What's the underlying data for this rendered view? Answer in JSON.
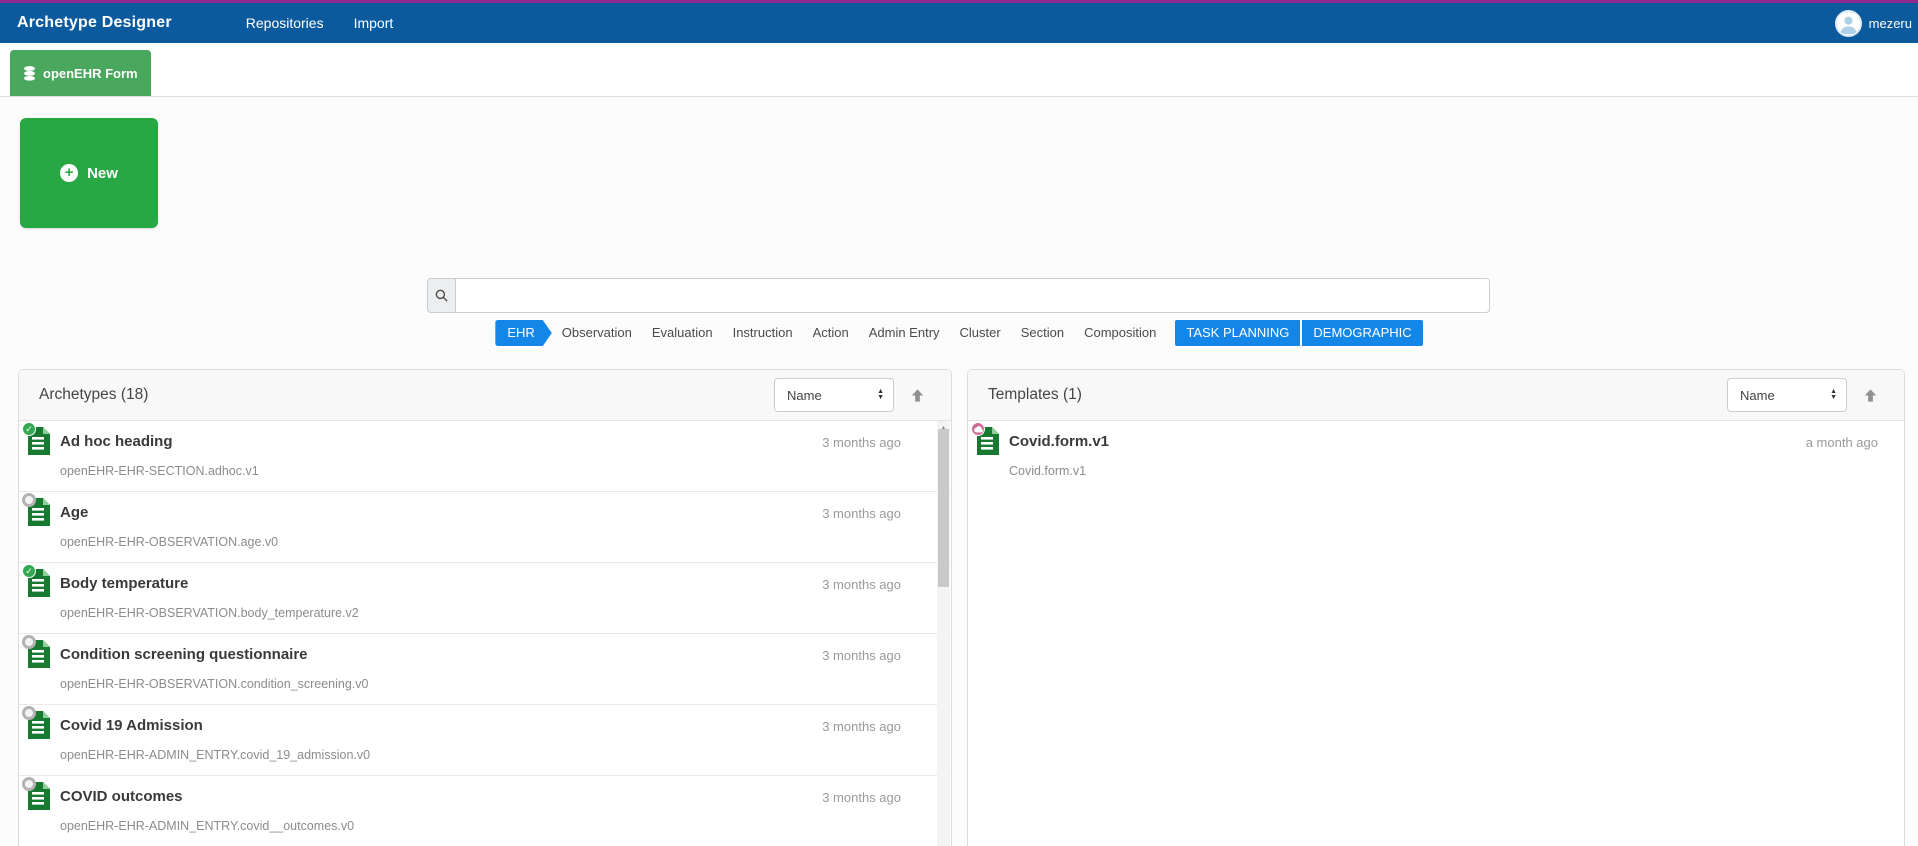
{
  "navbar": {
    "brand": "Archetype Designer",
    "links": [
      {
        "label": "Repositories"
      },
      {
        "label": "Import"
      }
    ],
    "user": "mezeru"
  },
  "tab": {
    "label": "openEHR Form"
  },
  "actions": {
    "new_label": "New"
  },
  "search": {
    "value": "",
    "placeholder": ""
  },
  "filters": {
    "active_primary": "EHR",
    "plain": [
      "Observation",
      "Evaluation",
      "Instruction",
      "Action",
      "Admin Entry",
      "Cluster",
      "Section",
      "Composition"
    ],
    "active_solid": [
      "TASK PLANNING",
      "DEMOGRAPHIC"
    ]
  },
  "archetypes_panel": {
    "title": "Archetypes (18)",
    "sort_value": "Name",
    "items": [
      {
        "name": "Ad hoc heading",
        "id": "openEHR-EHR-SECTION.adhoc.v1",
        "time": "3 months ago",
        "status": "checked"
      },
      {
        "name": "Age",
        "id": "openEHR-EHR-OBSERVATION.age.v0",
        "time": "3 months ago",
        "status": "unchecked"
      },
      {
        "name": "Body temperature",
        "id": "openEHR-EHR-OBSERVATION.body_temperature.v2",
        "time": "3 months ago",
        "status": "checked"
      },
      {
        "name": "Condition screening questionnaire",
        "id": "openEHR-EHR-OBSERVATION.condition_screening.v0",
        "time": "3 months ago",
        "status": "unchecked"
      },
      {
        "name": "Covid 19 Admission",
        "id": "openEHR-EHR-ADMIN_ENTRY.covid_19_admission.v0",
        "time": "3 months ago",
        "status": "unchecked"
      },
      {
        "name": "COVID outcomes",
        "id": "openEHR-EHR-ADMIN_ENTRY.covid__outcomes.v0",
        "time": "3 months ago",
        "status": "unchecked"
      }
    ]
  },
  "templates_panel": {
    "title": "Templates (1)",
    "sort_value": "Name",
    "items": [
      {
        "name": "Covid.form.v1",
        "id": "Covid.form.v1",
        "time": "a month ago",
        "status": "cloud"
      }
    ]
  },
  "colors": {
    "navbar_blue": "#0b5a9e",
    "top_strip_purple": "#8e2c8e",
    "accent_blue": "#1486e8",
    "button_green": "#28a745",
    "tab_green": "#4aa85e",
    "doc_icon_green": "#187a31",
    "badge_green": "#34a853",
    "badge_pink": "#cd6f99"
  }
}
